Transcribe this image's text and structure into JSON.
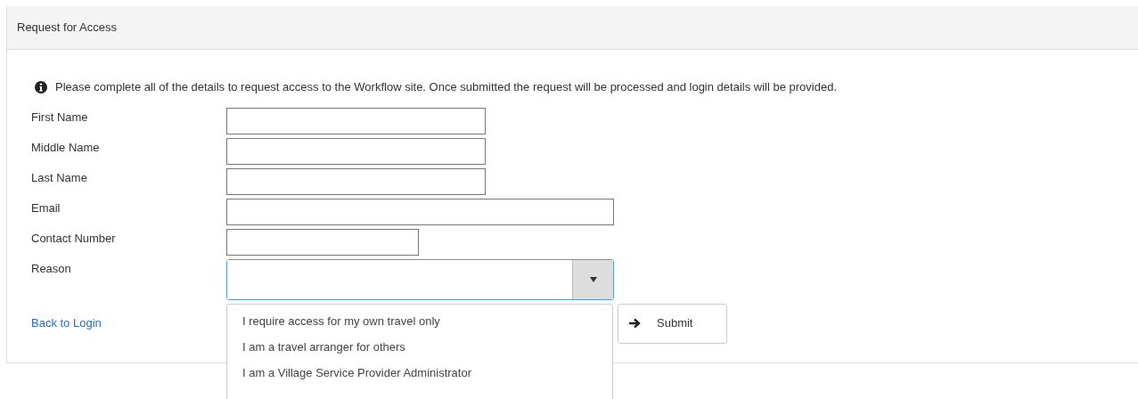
{
  "panel": {
    "title": "Request for Access"
  },
  "info": "Please complete all of the details to request access to the Workflow site. Once submitted the request will be processed and login details will be provided.",
  "fields": [
    {
      "label": "First Name"
    },
    {
      "label": "Middle Name"
    },
    {
      "label": "Last Name"
    },
    {
      "label": "Email"
    },
    {
      "label": "Contact Number"
    }
  ],
  "reason": {
    "label": "Reason",
    "expanded": true,
    "options": [
      {
        "label": "I require access for my own travel only",
        "selected": false
      },
      {
        "label": "I am a travel arranger for others",
        "selected": false
      },
      {
        "label": "I am a Village Service Provider Administrator",
        "selected": false
      }
    ]
  },
  "back_link": "Back to Login",
  "submit": "Submit"
}
